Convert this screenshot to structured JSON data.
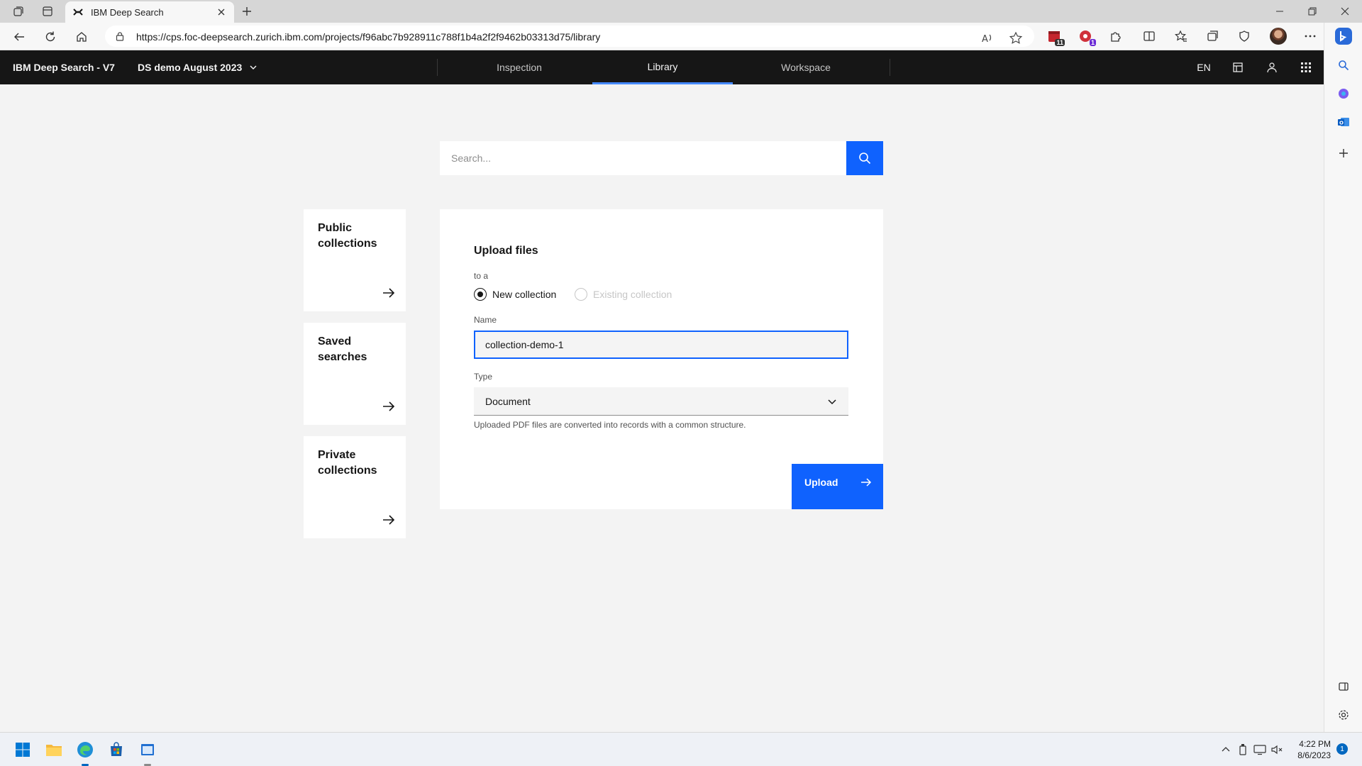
{
  "browser": {
    "tab_title": "IBM Deep Search",
    "url": "https://cps.foc-deepsearch.zurich.ibm.com/projects/f96abc7b928911c788f1b4a2f2f9462b03313d75/library",
    "extension_badges": {
      "ext1": "11",
      "ext2": "1"
    }
  },
  "app": {
    "brand": "IBM Deep Search - V7",
    "project": "DS demo August 2023",
    "nav_tabs": [
      {
        "label": "Inspection"
      },
      {
        "label": "Library"
      },
      {
        "label": "Workspace"
      }
    ],
    "active_tab": "Library",
    "language": "EN"
  },
  "search": {
    "placeholder": "Search..."
  },
  "side_cards": [
    {
      "label": "Public collections"
    },
    {
      "label": "Saved searches"
    },
    {
      "label": "Private collections"
    }
  ],
  "upload_panel": {
    "title": "Upload files",
    "to_label": "to a",
    "radio_new": "New collection",
    "radio_existing": "Existing collection",
    "selected_radio": "New collection",
    "name_label": "Name",
    "name_value": "collection-demo-1",
    "type_label": "Type",
    "type_value": "Document",
    "helper_text": "Uploaded PDF files are converted into records with a common structure.",
    "upload_label": "Upload"
  },
  "taskbar": {
    "time": "4:22 PM",
    "date": "8/6/2023",
    "notification_count": "1"
  },
  "colors": {
    "ibm_blue": "#0f62fe",
    "header_bg": "#161616",
    "page_bg": "#f3f3f3",
    "active_tab_underline": "#4589ff"
  }
}
